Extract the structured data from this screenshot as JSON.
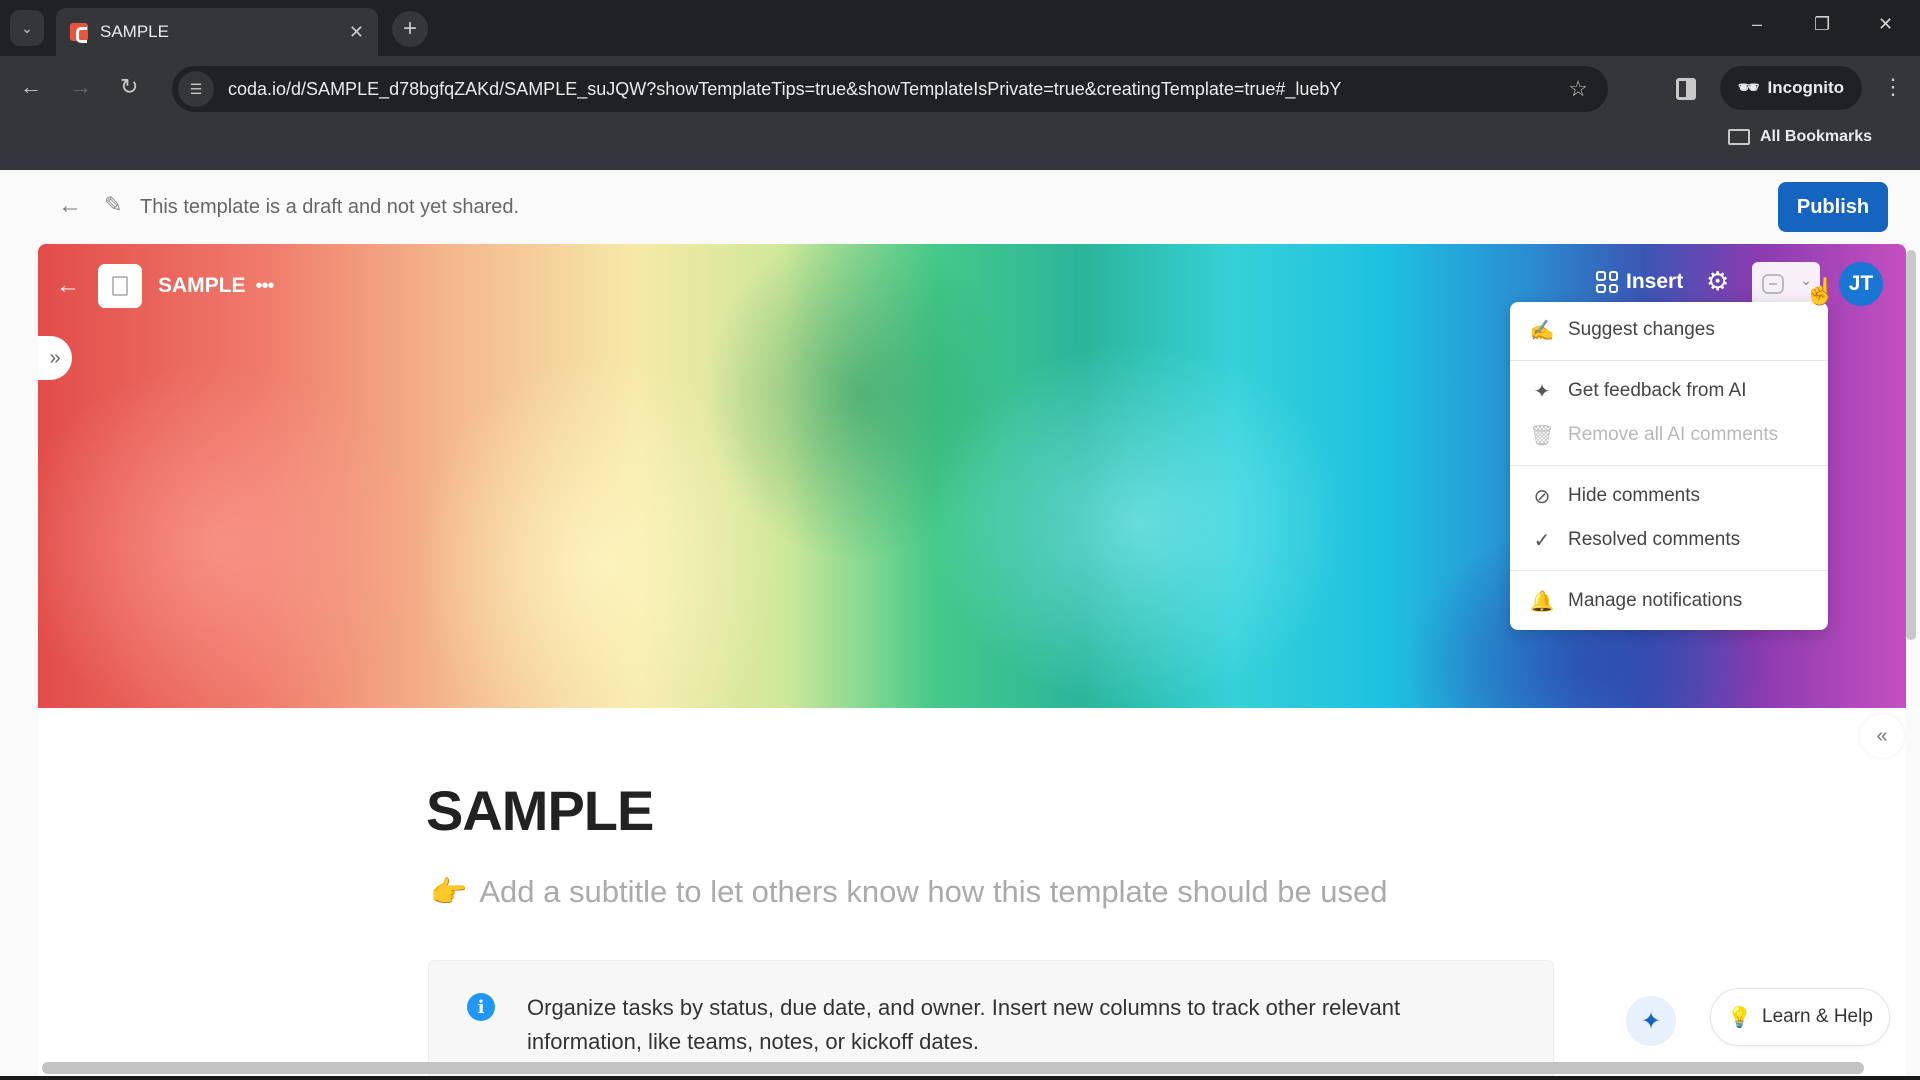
{
  "browser": {
    "tab_title": "SAMPLE",
    "tab_close": "✕",
    "new_tab": "+",
    "url": "coda.io/d/SAMPLE_d78bgfqZAKd/SAMPLE_suJQW?showTemplateTips=true&showTemplateIsPrivate=true&creatingTemplate=true#_luebY",
    "incognito_label": "Incognito",
    "bookmarks_label": "All Bookmarks",
    "window_controls": {
      "minimize": "–",
      "restore": "❐",
      "close": "✕"
    }
  },
  "draft_bar": {
    "message": "This template is a draft and not yet shared.",
    "publish_label": "Publish"
  },
  "doc_header": {
    "doc_name": "SAMPLE",
    "more": "•••",
    "insert_label": "Insert",
    "avatar_initials": "JT"
  },
  "comment_menu": {
    "items": [
      {
        "label": "Suggest changes",
        "icon": "suggest-changes-icon",
        "disabled": false
      },
      {
        "label": "Get feedback from AI",
        "icon": "sparkles-icon",
        "disabled": false
      },
      {
        "label": "Remove all AI comments",
        "icon": "trash-icon",
        "disabled": true
      },
      {
        "label": "Hide comments",
        "icon": "eye-off-icon",
        "disabled": false
      },
      {
        "label": "Resolved comments",
        "icon": "check-circle-icon",
        "disabled": false
      },
      {
        "label": "Manage notifications",
        "icon": "bell-icon",
        "disabled": false
      }
    ]
  },
  "content": {
    "title": "SAMPLE",
    "subtitle_placeholder": "Add a subtitle to let others know how this template should be used",
    "callout_text": "Organize tasks by status, due date, and owner. Insert new columns to track other relevant information, like teams, notes, or kickoff dates."
  },
  "footer": {
    "help_label": "Learn & Help"
  },
  "colors": {
    "publish": "#1565c0",
    "avatar": "#1976d2",
    "info": "#2196f3"
  }
}
